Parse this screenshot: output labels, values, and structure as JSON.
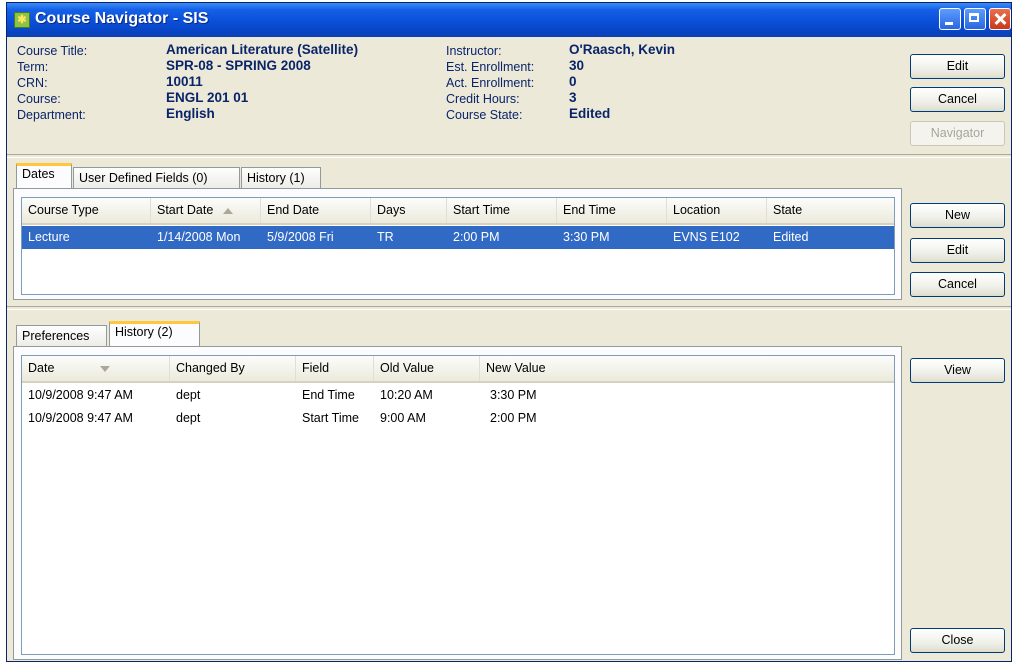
{
  "window": {
    "title": "Course Navigator - SIS"
  },
  "course": {
    "left": [
      {
        "label": "Course Title:",
        "value": "American Literature (Satellite)"
      },
      {
        "label": "Term:",
        "value": "SPR-08 - SPRING 2008"
      },
      {
        "label": "CRN:",
        "value": "10011"
      },
      {
        "label": "Course:",
        "value": "ENGL 201 01"
      },
      {
        "label": "Department:",
        "value": "English"
      }
    ],
    "right": [
      {
        "label": "Instructor:",
        "value": "O'Raasch, Kevin"
      },
      {
        "label": "Est. Enrollment:",
        "value": "30"
      },
      {
        "label": "Act. Enrollment:",
        "value": "0"
      },
      {
        "label": "Credit Hours:",
        "value": "3"
      },
      {
        "label": "Course State:",
        "value": "Edited"
      }
    ]
  },
  "top_buttons": {
    "edit": "Edit",
    "cancel": "Cancel",
    "navigator": "Navigator"
  },
  "upper_tabs": [
    "Dates",
    "User Defined Fields (0)",
    "History (1)"
  ],
  "dates_grid": {
    "columns": [
      "Course Type",
      "Start Date",
      "End Date",
      "Days",
      "Start Time",
      "End Time",
      "Location",
      "State"
    ],
    "rows": [
      [
        "Lecture",
        "1/14/2008 Mon",
        "5/9/2008 Fri",
        "TR",
        "2:00 PM",
        "3:30 PM",
        "EVNS E102",
        "Edited"
      ]
    ]
  },
  "dates_buttons": {
    "new": "New",
    "edit": "Edit",
    "cancel": "Cancel"
  },
  "lower_tabs": [
    "Preferences",
    "History (2)"
  ],
  "history_grid": {
    "columns": [
      "Date",
      "Changed By",
      "Field",
      "Old Value",
      "New Value"
    ],
    "rows": [
      [
        "10/9/2008 9:47 AM",
        "dept",
        "End Time",
        "10:20 AM",
        "3:30 PM"
      ],
      [
        "10/9/2008 9:47 AM",
        "dept",
        "Start Time",
        "9:00 AM",
        "2:00 PM"
      ]
    ]
  },
  "history_buttons": {
    "view": "View",
    "close": "Close"
  },
  "colors": {
    "title_bar": "#0a4fd8",
    "selection": "#316ac5",
    "label_text": "#0a246a",
    "tab_highlight": "#ffc83c"
  }
}
